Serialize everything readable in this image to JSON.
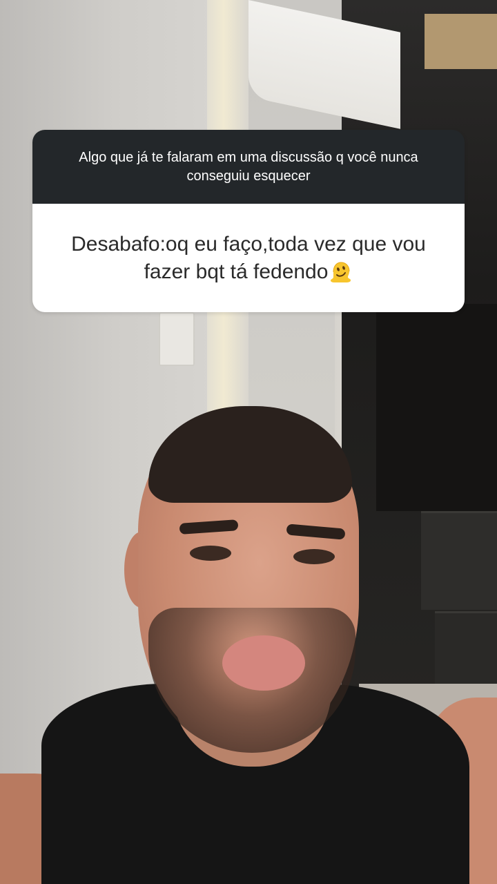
{
  "question_sticker": {
    "question": "Algo que já te falaram em uma discussão q você nunca conseguiu esquecer",
    "answer_line1": "Desabafo:oq eu faço,toda vez que vou",
    "answer_line2": "fazer bqt tá fedendo",
    "answer_emoji": "melting-face-emoji"
  },
  "colors": {
    "header_bg": "#23272a",
    "answer_bg": "#ffffff",
    "answer_text": "#2a2a2a"
  },
  "background": {
    "type": "video-frame"
  }
}
